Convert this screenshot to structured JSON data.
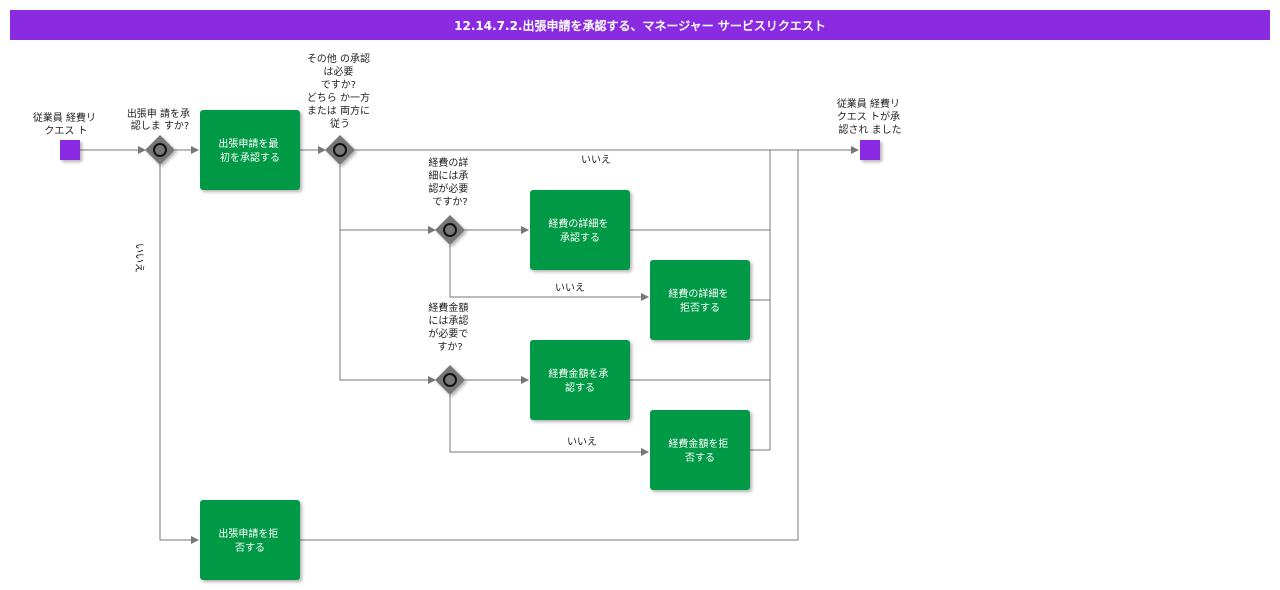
{
  "title": "12.14.7.2.出張申請を承認する、マネージャー サービスリクエスト",
  "colors": {
    "title_bg": "#8a2be2",
    "event": "#8a2be2",
    "task": "#009944",
    "gateway": "#777777",
    "edge": "#777777"
  },
  "start_event": {
    "label": [
      "従業員 経費リ",
      "クエス ト"
    ]
  },
  "end_event": {
    "label": [
      "従業員 経費リ",
      "クエス トが承",
      "認され ました"
    ]
  },
  "gateways": {
    "approve_trip": {
      "label": [
        "出張申 請を承",
        "認しま すか?"
      ]
    },
    "other_approval": {
      "label": [
        "その他 の承認",
        "は必要",
        "ですか?",
        "どちら か一方",
        "または 両方に",
        "従う"
      ]
    },
    "expense_detail": {
      "label": [
        "経費の詳",
        "細には承",
        "認が必要",
        "ですか?"
      ]
    },
    "expense_amount": {
      "label": [
        "経費金額",
        "には承認",
        "が必要で",
        "すか?"
      ]
    }
  },
  "tasks": {
    "first_approve": {
      "label": [
        "出張申請を最",
        "初を承認する"
      ]
    },
    "approve_detail": {
      "label": [
        "経費の詳細を",
        "承認する"
      ]
    },
    "reject_detail": {
      "label": [
        "経費の詳細を",
        "拒否する"
      ]
    },
    "approve_amount": {
      "label": [
        "経費金額を承",
        "認する"
      ]
    },
    "reject_amount": {
      "label": [
        "経費金額を拒",
        "否する"
      ]
    },
    "reject_trip": {
      "label": [
        "出張申請を拒",
        "否する"
      ]
    }
  },
  "edge_labels": {
    "no_top": "いいえ",
    "no_detail": "いいえ",
    "no_amount": "いいえ",
    "no_reject_trip": "いいえ"
  }
}
